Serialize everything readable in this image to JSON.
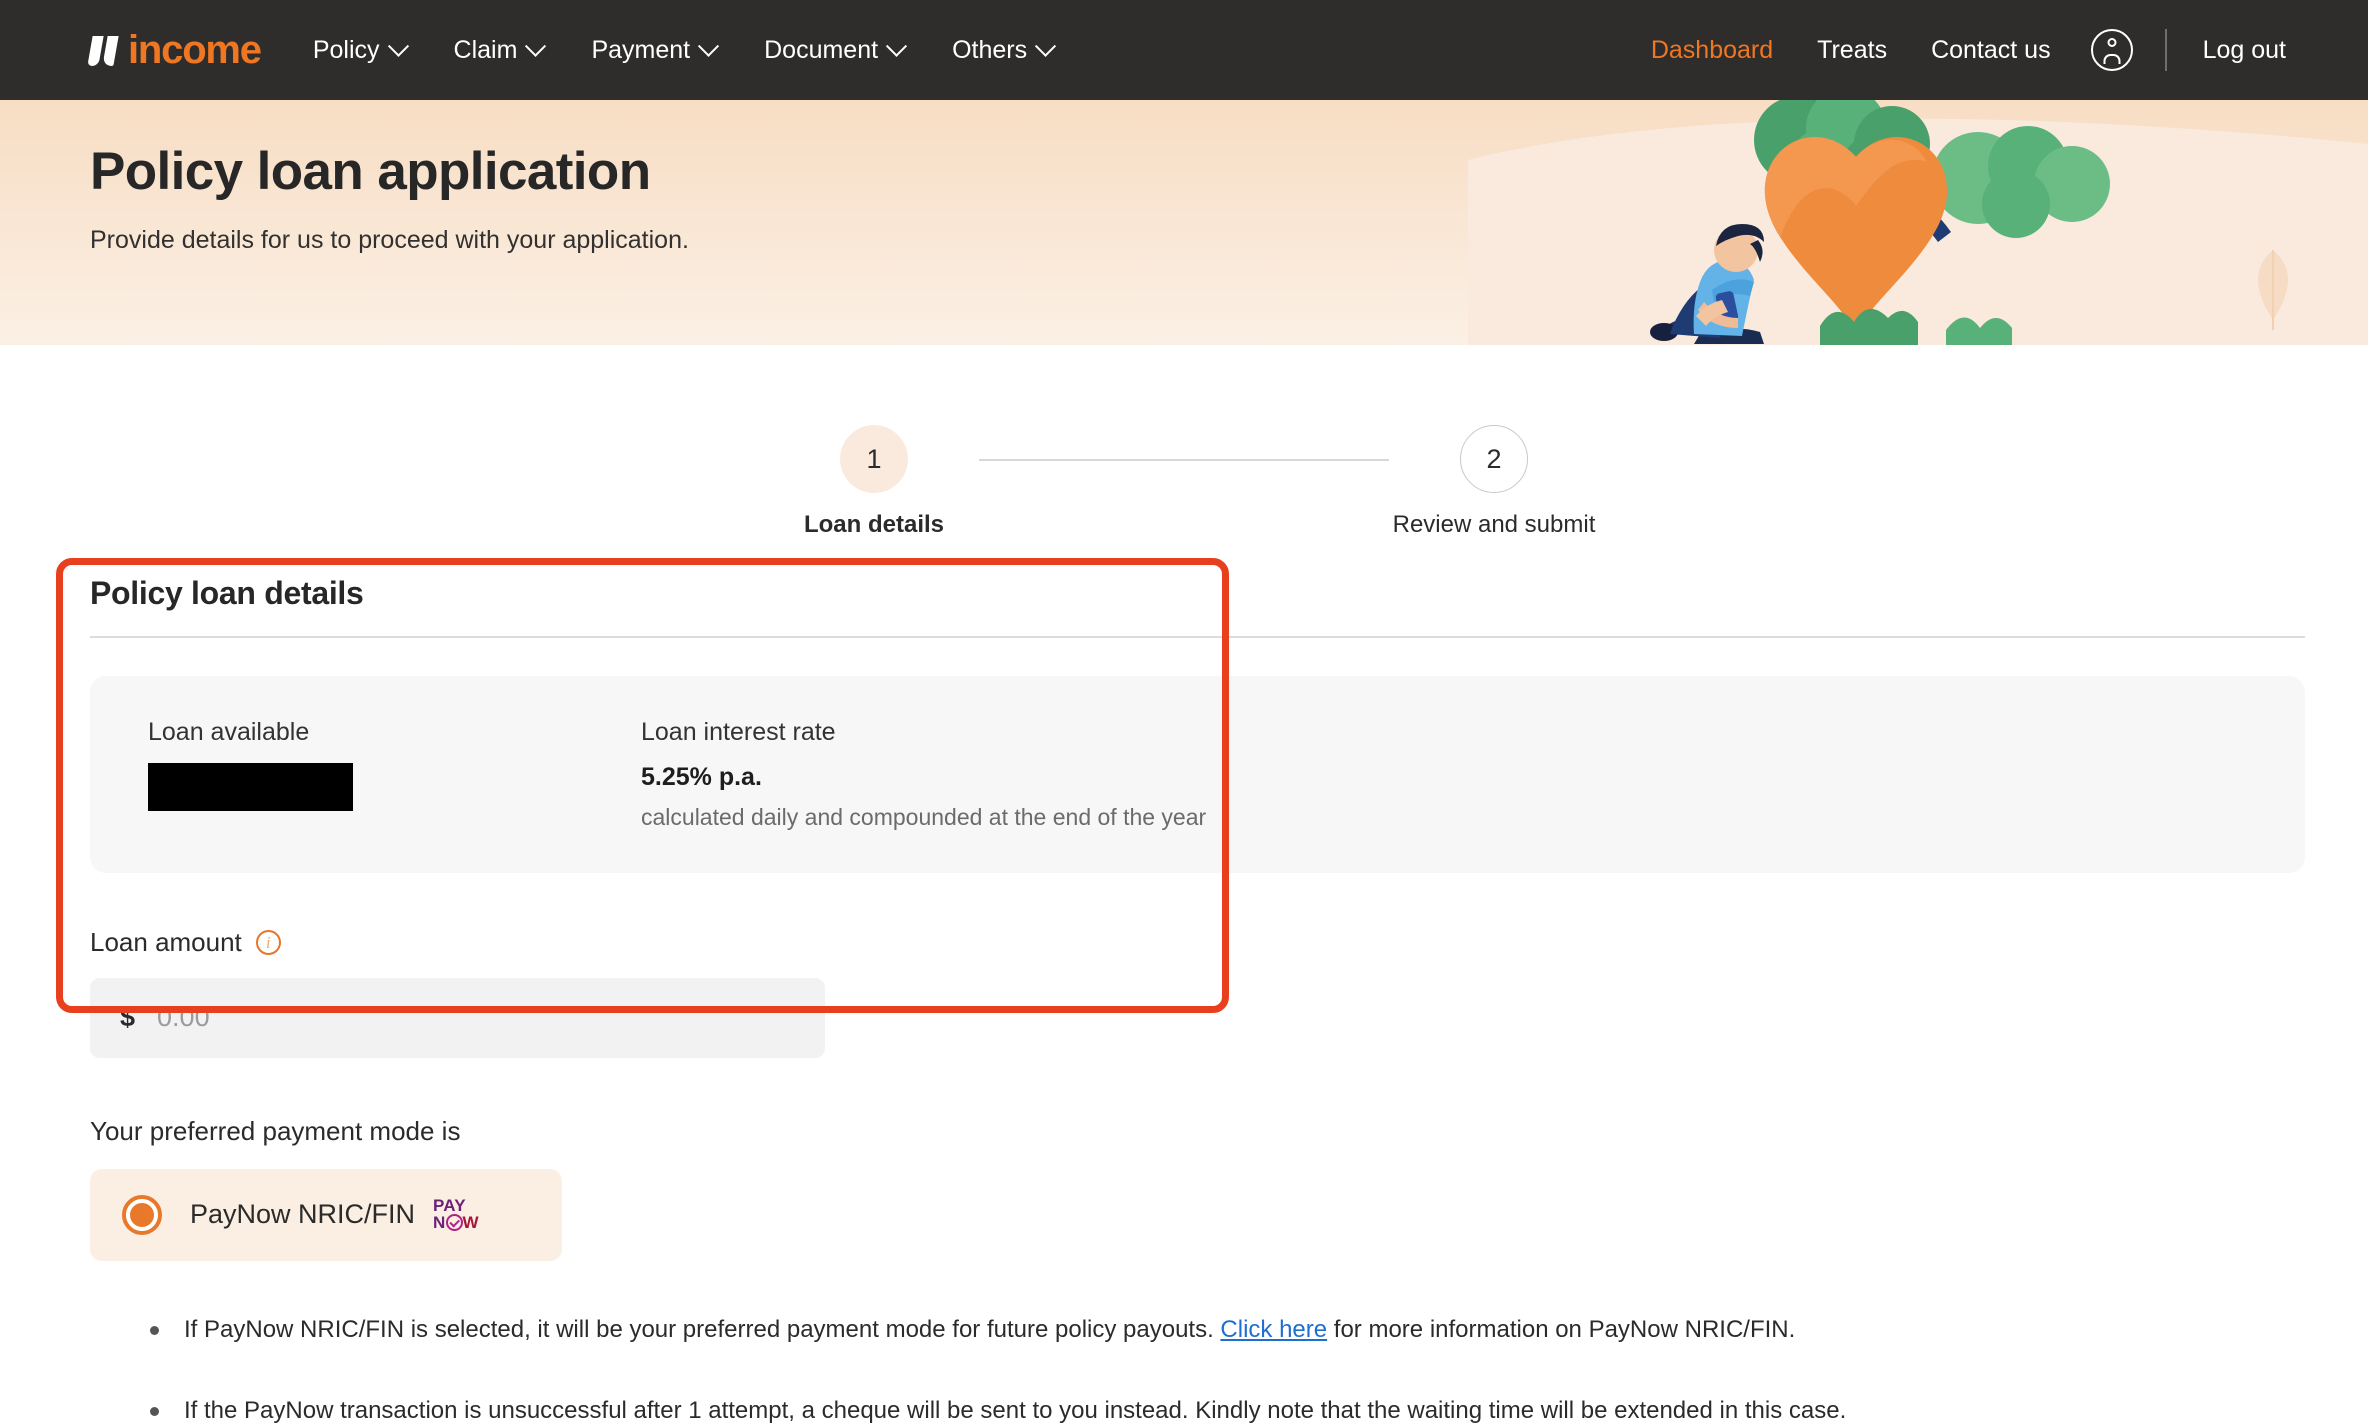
{
  "brand": {
    "name": "income"
  },
  "nav": {
    "left_items": [
      {
        "label": "Policy",
        "has_caret": true
      },
      {
        "label": "Claim",
        "has_caret": true
      },
      {
        "label": "Payment",
        "has_caret": true
      },
      {
        "label": "Document",
        "has_caret": true
      },
      {
        "label": "Others",
        "has_caret": true
      }
    ],
    "right_items": [
      {
        "label": "Dashboard",
        "active": true
      },
      {
        "label": "Treats",
        "active": false
      },
      {
        "label": "Contact us",
        "active": false
      }
    ],
    "logout_label": "Log out",
    "active_color": "#ef7622",
    "bar_color": "#2e2d2b"
  },
  "hero": {
    "title": "Policy loan application",
    "subtitle": "Provide details for us to proceed with your application.",
    "gradient_from": "#f7ddc3",
    "gradient_to": "#fbf0e5"
  },
  "stepper": {
    "steps": [
      {
        "number": "1",
        "label": "Loan details",
        "state": "current"
      },
      {
        "number": "2",
        "label": "Review and submit",
        "state": "upcoming"
      }
    ]
  },
  "card": {
    "title": "Policy loan details",
    "loan_available": {
      "label": "Loan available",
      "value": "",
      "redacted": true
    },
    "loan_interest_rate": {
      "label": "Loan interest rate",
      "value": "5.25% p.a.",
      "note": "calculated daily and compounded at the end of the year"
    },
    "loan_amount": {
      "label": "Loan amount",
      "currency_symbol": "$",
      "value": "",
      "placeholder": "0.00",
      "info_icon": "info-icon"
    }
  },
  "payment_mode": {
    "heading": "Your preferred payment mode is",
    "selected_option": "PayNow NRIC/FIN",
    "logo_text": {
      "top": "PAY",
      "bottom_left": "N",
      "bottom_right": "W"
    },
    "accent_color": "#e8782a"
  },
  "notes": {
    "items": [
      {
        "before": "If PayNow NRIC/FIN is selected, it will be your preferred payment mode for future policy payouts. ",
        "link": "Click here",
        "after": " for more information on PayNow NRIC/FIN."
      },
      {
        "before": "If the PayNow transaction is unsuccessful after 1 attempt, a cheque will be sent to you instead. Kindly note that the waiting time will be extended in this case.",
        "link": "",
        "after": ""
      }
    ]
  },
  "annotation": {
    "color": "#e8401f",
    "target": "policy-loan-details-card"
  }
}
